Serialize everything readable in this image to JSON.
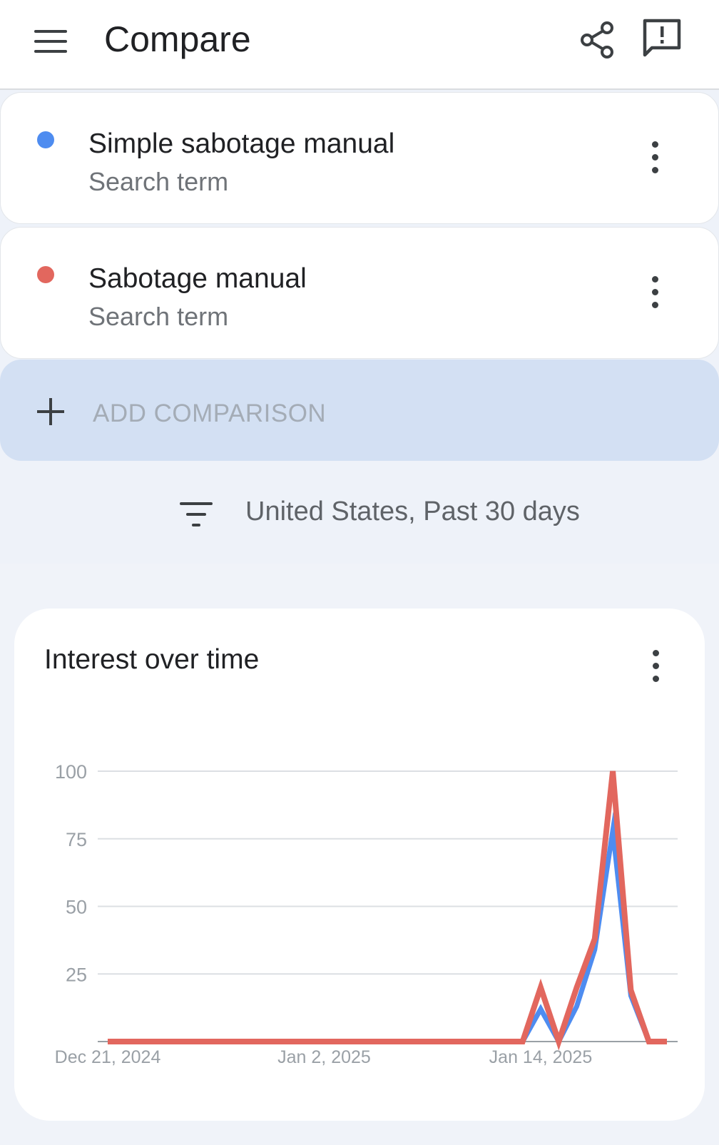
{
  "header": {
    "title": "Compare",
    "menu_icon": "hamburger-menu-icon",
    "share_icon": "share-icon",
    "feedback_icon": "feedback-icon"
  },
  "terms": [
    {
      "name": "Simple sabotage manual",
      "type": "Search term",
      "color": "#4e8cf0"
    },
    {
      "name": "Sabotage manual",
      "type": "Search term",
      "color": "#e2675e"
    }
  ],
  "add_comparison": {
    "label": "ADD COMPARISON"
  },
  "filter": {
    "text": "United States, Past 30 days",
    "icon": "filter-icon"
  },
  "chart_card": {
    "title": "Interest over time"
  },
  "chart_data": {
    "type": "line",
    "title": "Interest over time",
    "x_tick_labels": [
      "Dec 21, 2024",
      "Jan 2, 2025",
      "Jan 14, 2025"
    ],
    "y_ticks": [
      25,
      50,
      75,
      100
    ],
    "ylim": [
      0,
      100
    ],
    "grid": true,
    "x": [
      "Dec 21",
      "Dec 22",
      "Dec 23",
      "Dec 24",
      "Dec 25",
      "Dec 26",
      "Dec 27",
      "Dec 28",
      "Dec 29",
      "Dec 30",
      "Dec 31",
      "Jan 1",
      "Jan 2",
      "Jan 3",
      "Jan 4",
      "Jan 5",
      "Jan 6",
      "Jan 7",
      "Jan 8",
      "Jan 9",
      "Jan 10",
      "Jan 11",
      "Jan 12",
      "Jan 13",
      "Jan 14",
      "Jan 15",
      "Jan 16",
      "Jan 17",
      "Jan 18",
      "Jan 19",
      "Jan 20",
      "Jan 21"
    ],
    "series": [
      {
        "name": "Simple sabotage manual",
        "color": "#4e8cf0",
        "values": [
          0,
          0,
          0,
          0,
          0,
          0,
          0,
          0,
          0,
          0,
          0,
          0,
          0,
          0,
          0,
          0,
          0,
          0,
          0,
          0,
          0,
          0,
          0,
          0,
          12,
          0,
          13,
          34,
          78,
          17,
          0,
          0
        ]
      },
      {
        "name": "Sabotage manual",
        "color": "#e2675e",
        "values": [
          0,
          0,
          0,
          0,
          0,
          0,
          0,
          0,
          0,
          0,
          0,
          0,
          0,
          0,
          0,
          0,
          0,
          0,
          0,
          0,
          0,
          0,
          0,
          0,
          20,
          0,
          20,
          38,
          100,
          19,
          0,
          0
        ]
      }
    ]
  }
}
